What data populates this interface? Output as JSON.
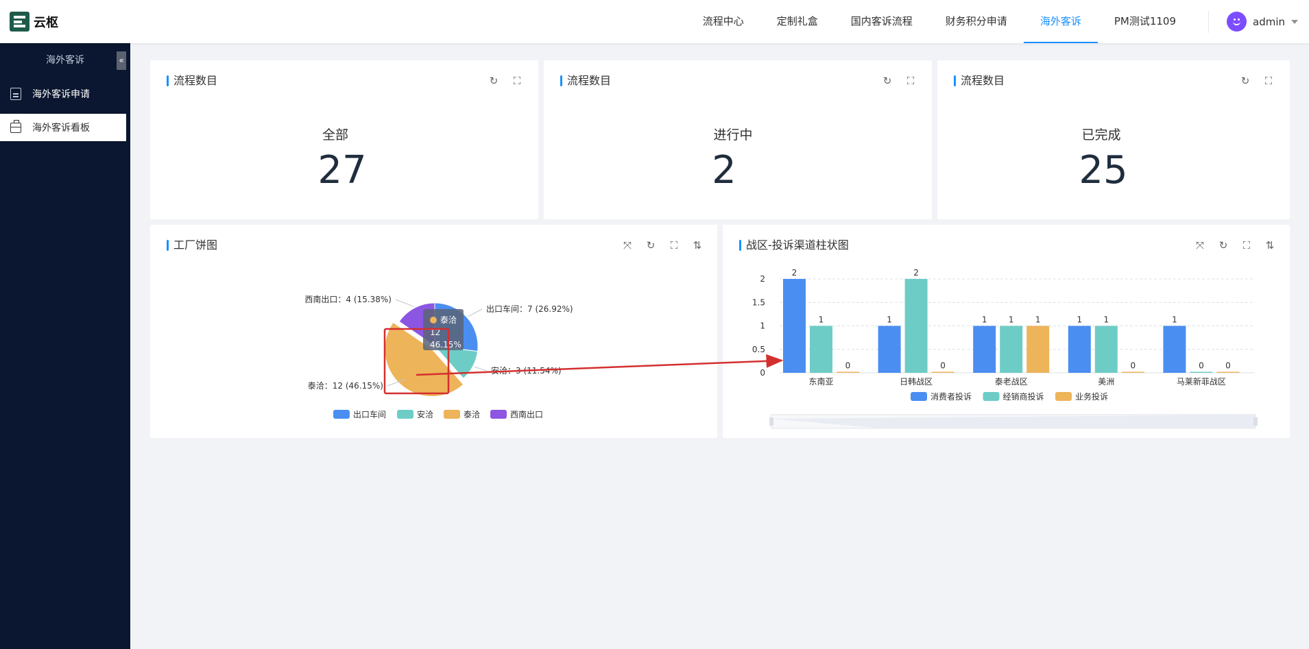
{
  "app": {
    "name": "云枢"
  },
  "nav": {
    "items": [
      "流程中心",
      "定制礼盒",
      "国内客诉流程",
      "财务积分申请",
      "海外客诉",
      "PM测试1109"
    ],
    "active_index": 4,
    "user": "admin"
  },
  "sidebar": {
    "title": "海外客诉",
    "collapse_glyph": "«",
    "items": [
      {
        "label": "海外客诉申请",
        "icon": "document-icon"
      },
      {
        "label": "海外客诉看板",
        "icon": "dashboard-icon",
        "active": true
      }
    ]
  },
  "stats": [
    {
      "title": "流程数目",
      "label": "全部",
      "value": "27"
    },
    {
      "title": "流程数目",
      "label": "进行中",
      "value": "2"
    },
    {
      "title": "流程数目",
      "label": "已完成",
      "value": "25"
    }
  ],
  "pie_card": {
    "title": "工厂饼图"
  },
  "bar_card": {
    "title": "战区-投诉渠道柱状图"
  },
  "colors": {
    "accent": "#1890ff",
    "sidebar": "#0b1730",
    "blue": "#4b8ef2",
    "teal": "#6dcdc6",
    "orange": "#eeb45a",
    "purple": "#8c56e3",
    "annotation": "#d32f2f"
  },
  "chart_data": [
    {
      "type": "pie",
      "title": "工厂饼图",
      "labels": [
        "出口车间",
        "安洽",
        "泰洽",
        "西南出口"
      ],
      "values": [
        7,
        3,
        12,
        4
      ],
      "slice_labels": [
        "出口车间：7 (26.92%)",
        "安洽：3 (11.54%)",
        "泰洽：12 (46.15%)",
        "西南出口：4 (15.38%)"
      ],
      "legend": "bottom",
      "tooltip": {
        "name": "泰洽",
        "value": "12",
        "percent": "46.15%"
      }
    },
    {
      "type": "bar",
      "title": "战区-投诉渠道柱状图",
      "categories": [
        "东南亚",
        "日韩战区",
        "泰老战区",
        "美洲",
        "马莱新菲战区"
      ],
      "series": [
        {
          "name": "消费者投诉",
          "values": [
            2,
            1,
            1,
            1,
            1
          ]
        },
        {
          "name": "经销商投诉",
          "values": [
            1,
            2,
            1,
            1,
            0
          ]
        },
        {
          "name": "业务投诉",
          "values": [
            0,
            0,
            1,
            0,
            0
          ]
        }
      ],
      "y_ticks": [
        "0",
        "0.5",
        "1",
        "1.5",
        "2"
      ],
      "ylim": [
        0,
        2
      ],
      "grid": true,
      "legend": "bottom"
    }
  ]
}
